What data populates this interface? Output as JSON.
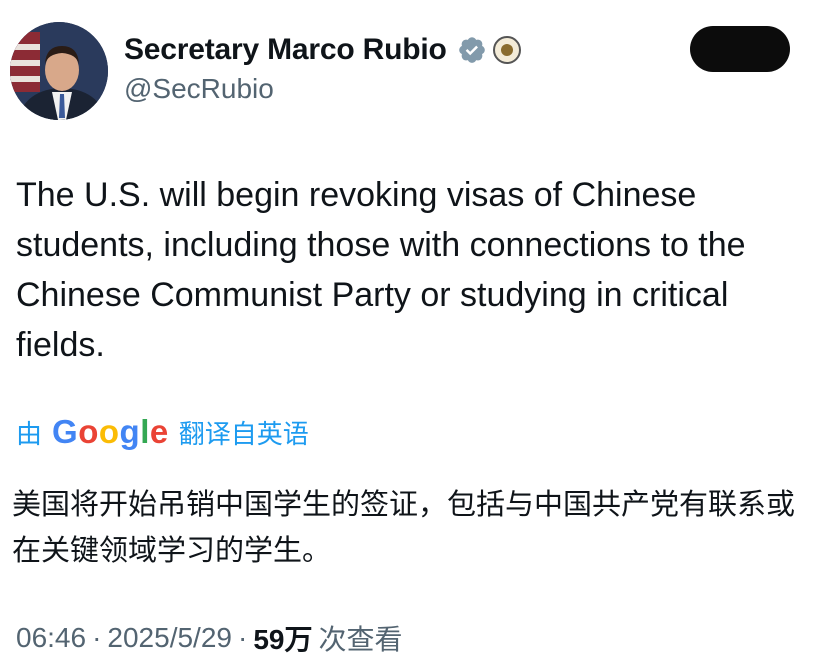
{
  "author": {
    "display_name": "Secretary Marco Rubio",
    "handle": "@SecRubio",
    "verified_badge_color": "#829aab"
  },
  "post": {
    "text": "The U.S. will begin revoking visas of Chinese students, including those with connections to the Chinese Communist Party or studying in critical fields."
  },
  "translation": {
    "prefix": "由",
    "provider": "Google",
    "suffix": "翻译自英语",
    "text": "美国将开始吊销中国学生的签证，包括与中国共产党有联系或在关键领域学习的学生。",
    "link_color": "#1d9bf0"
  },
  "meta": {
    "time": "06:46",
    "date": "2025/5/29",
    "separator": "·",
    "views_count": "59万",
    "views_label": "次查看"
  },
  "icons": {
    "verified": "verified-check-icon",
    "seal": "state-department-seal-icon"
  }
}
